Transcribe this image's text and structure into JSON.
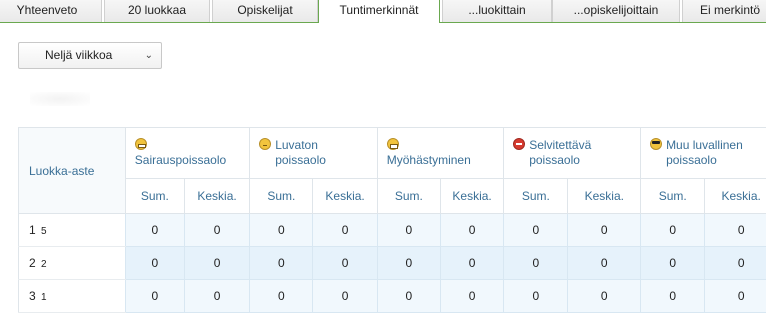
{
  "tabs": [
    {
      "label": "Yhteenveto",
      "active": false
    },
    {
      "label": "20 luokkaa",
      "active": false
    },
    {
      "label": "Opiskelijat",
      "active": false
    },
    {
      "label": "Tuntimerkinnät",
      "active": true
    },
    {
      "label": "...luokittain",
      "active": false
    },
    {
      "label": "...opiskelijoittain",
      "active": false
    },
    {
      "label": "Ei merkintö",
      "active": false
    }
  ],
  "period_select": {
    "value": "Neljä viikkoa",
    "icon": "chevron-down-icon"
  },
  "table": {
    "corner_header": "Luokka-aste",
    "groups": [
      {
        "label": "Sairauspoissaolo",
        "icon": "smile-icon"
      },
      {
        "label": "Luvaton poissaolo",
        "icon": "sleepy-icon"
      },
      {
        "label": "Myöhästyminen",
        "icon": "tongue-icon"
      },
      {
        "label": "Selvitettävä poissaolo",
        "icon": "stop-icon"
      },
      {
        "label": "Muu luvallinen poissaolo",
        "icon": "cool-icon"
      }
    ],
    "sub_headers": [
      "Sum.",
      "Keskia."
    ],
    "rows": [
      {
        "grade": "1",
        "count": "5",
        "values": [
          "0",
          "0",
          "0",
          "0",
          "0",
          "0",
          "0",
          "0",
          "0",
          "0"
        ]
      },
      {
        "grade": "2",
        "count": "2",
        "values": [
          "0",
          "0",
          "0",
          "0",
          "0",
          "0",
          "0",
          "0",
          "0",
          "0"
        ]
      },
      {
        "grade": "3",
        "count": "1",
        "values": [
          "0",
          "0",
          "0",
          "0",
          "0",
          "0",
          "0",
          "0",
          "0",
          "0"
        ]
      }
    ]
  }
}
